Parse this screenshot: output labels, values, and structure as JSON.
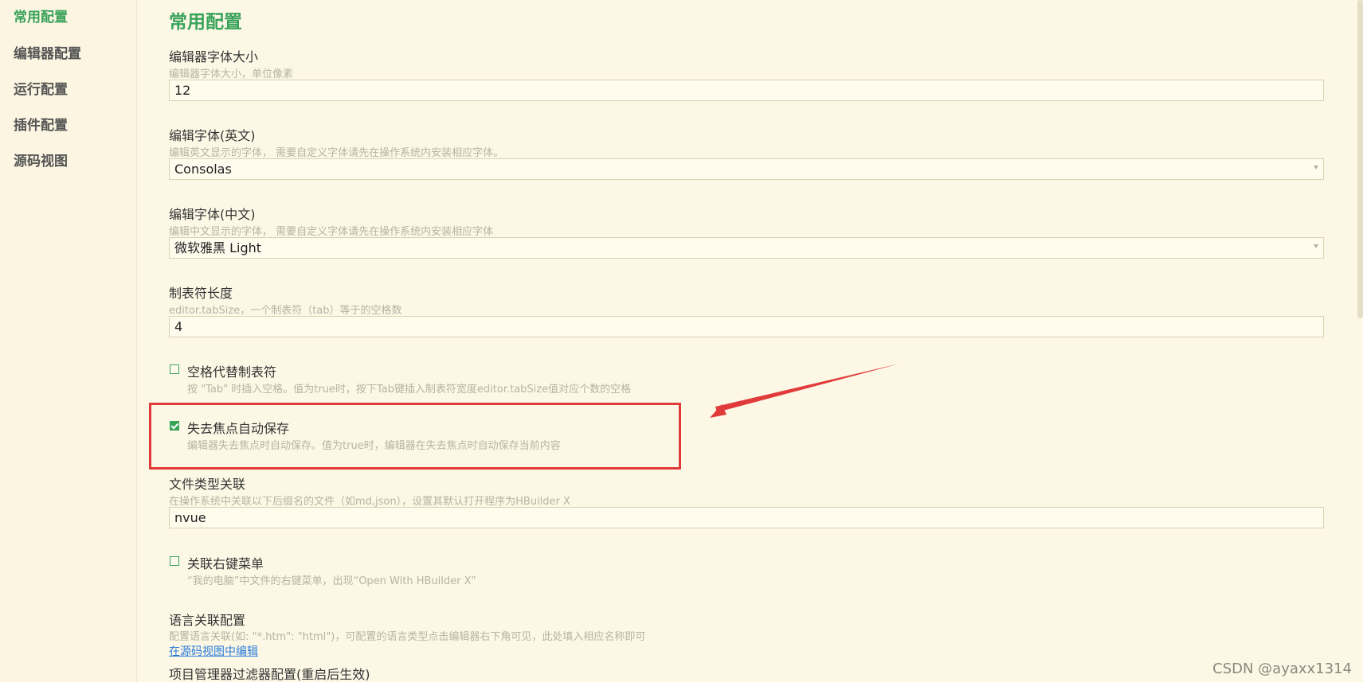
{
  "sidebar": {
    "items": [
      {
        "label": "常用配置",
        "active": true
      },
      {
        "label": "编辑器配置",
        "active": false
      },
      {
        "label": "运行配置",
        "active": false
      },
      {
        "label": "插件配置",
        "active": false
      },
      {
        "label": "源码视图",
        "active": false
      }
    ]
  },
  "main": {
    "title": "常用配置",
    "settings": {
      "font_size": {
        "label": "编辑器字体大小",
        "desc": "编辑器字体大小，单位像素",
        "value": "12"
      },
      "font_en": {
        "label": "编辑字体(英文)",
        "desc": "编辑英文显示的字体， 需要自定义字体请先在操作系统内安装相应字体。",
        "value": "Consolas"
      },
      "font_cn": {
        "label": "编辑字体(中文)",
        "desc": "编辑中文显示的字体， 需要自定义字体请先在操作系统内安装相应字体",
        "value": "微软雅黑 Light"
      },
      "tab_size": {
        "label": "制表符长度",
        "desc": "editor.tabSize，一个制表符（tab）等于的空格数",
        "value": "4"
      },
      "insert_spaces": {
        "label": "空格代替制表符",
        "desc": "按 \"Tab\" 时插入空格。值为true时，按下Tab键插入制表符宽度editor.tabSize值对应个数的空格",
        "checked": false
      },
      "auto_save": {
        "label": "失去焦点自动保存",
        "desc": "编辑器失去焦点时自动保存。值为true时，编辑器在失去焦点时自动保存当前内容",
        "checked": true
      },
      "file_assoc": {
        "label": "文件类型关联",
        "desc": "在操作系统中关联以下后缀名的文件（如md,json），设置其默认打开程序为HBuilder X",
        "value": "nvue"
      },
      "context_menu": {
        "label": "关联右键菜单",
        "desc": "“我的电脑”中文件的右键菜单，出现“Open With HBuilder X”",
        "checked": false
      },
      "lang_assoc": {
        "label": "语言关联配置",
        "desc": "配置语言关联(如: \"*.htm\": \"html\")，可配置的语言类型点击编辑器右下角可见，此处填入相应名称即可",
        "link": "在源码视图中编辑"
      },
      "project_filter": {
        "label": "项目管理器过滤器配置(重启后生效)"
      }
    }
  },
  "colors": {
    "accent": "#3aa35a",
    "highlight": "#e03a3a",
    "background": "#fdf8e6"
  },
  "watermark": "CSDN @ayaxx1314"
}
